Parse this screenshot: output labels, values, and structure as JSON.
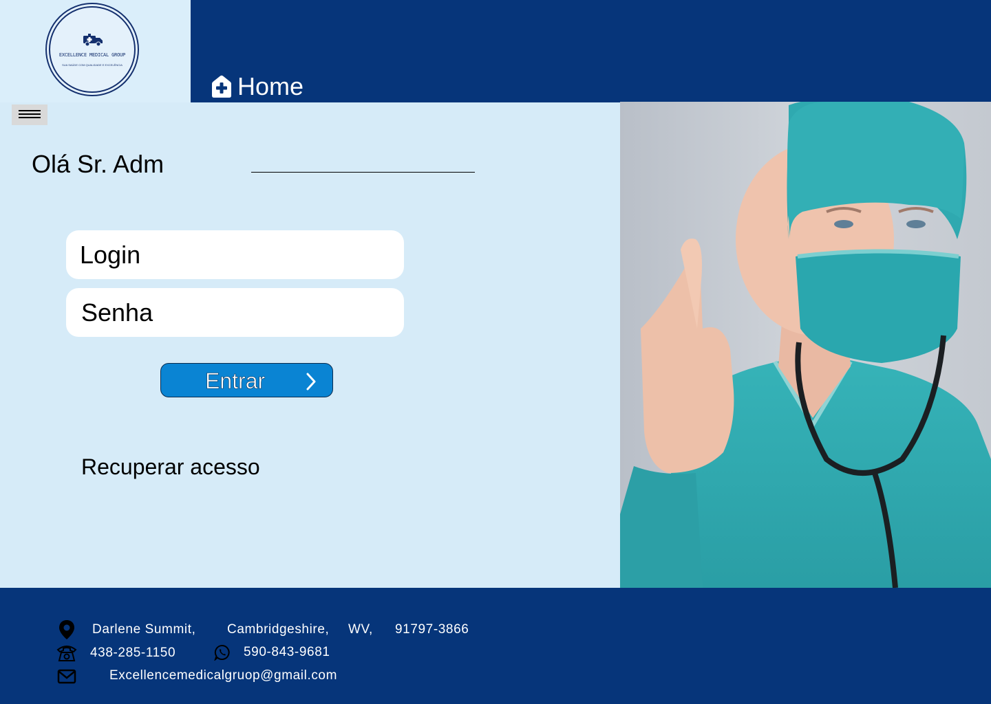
{
  "logo": {
    "name": "EXCELLENCE MEDICAL GROUP",
    "slogan": "SUA SAÚDE COM QUALIDADE E EXCELÊNCIA"
  },
  "header": {
    "home_label": "Home",
    "home_icon": "home-plus-icon",
    "menu_icon": "hamburger-menu-icon"
  },
  "main": {
    "greeting": "Olá Sr. Adm",
    "login_placeholder": "Login",
    "password_placeholder": "Senha",
    "enter_label": "Entrar",
    "enter_icon": "chevron-right-icon",
    "recover_label": "Recuperar acesso"
  },
  "footer": {
    "address": {
      "icon": "location-pin-icon",
      "street": "Darlene Summit,",
      "county": "Cambridgeshire,",
      "state": "WV,",
      "zip": "91797-3866"
    },
    "phone": {
      "icon": "telephone-icon",
      "number": "438-285-1150"
    },
    "whatsapp": {
      "icon": "whatsapp-icon",
      "number": "590-843-9681"
    },
    "email": {
      "icon": "mail-icon",
      "address": "Excellencemedicalgruop@gmail.com"
    }
  },
  "colors": {
    "navy": "#06357a",
    "light_blue": "#d6ebf8",
    "button_blue": "#0a84d3",
    "white": "#ffffff"
  }
}
